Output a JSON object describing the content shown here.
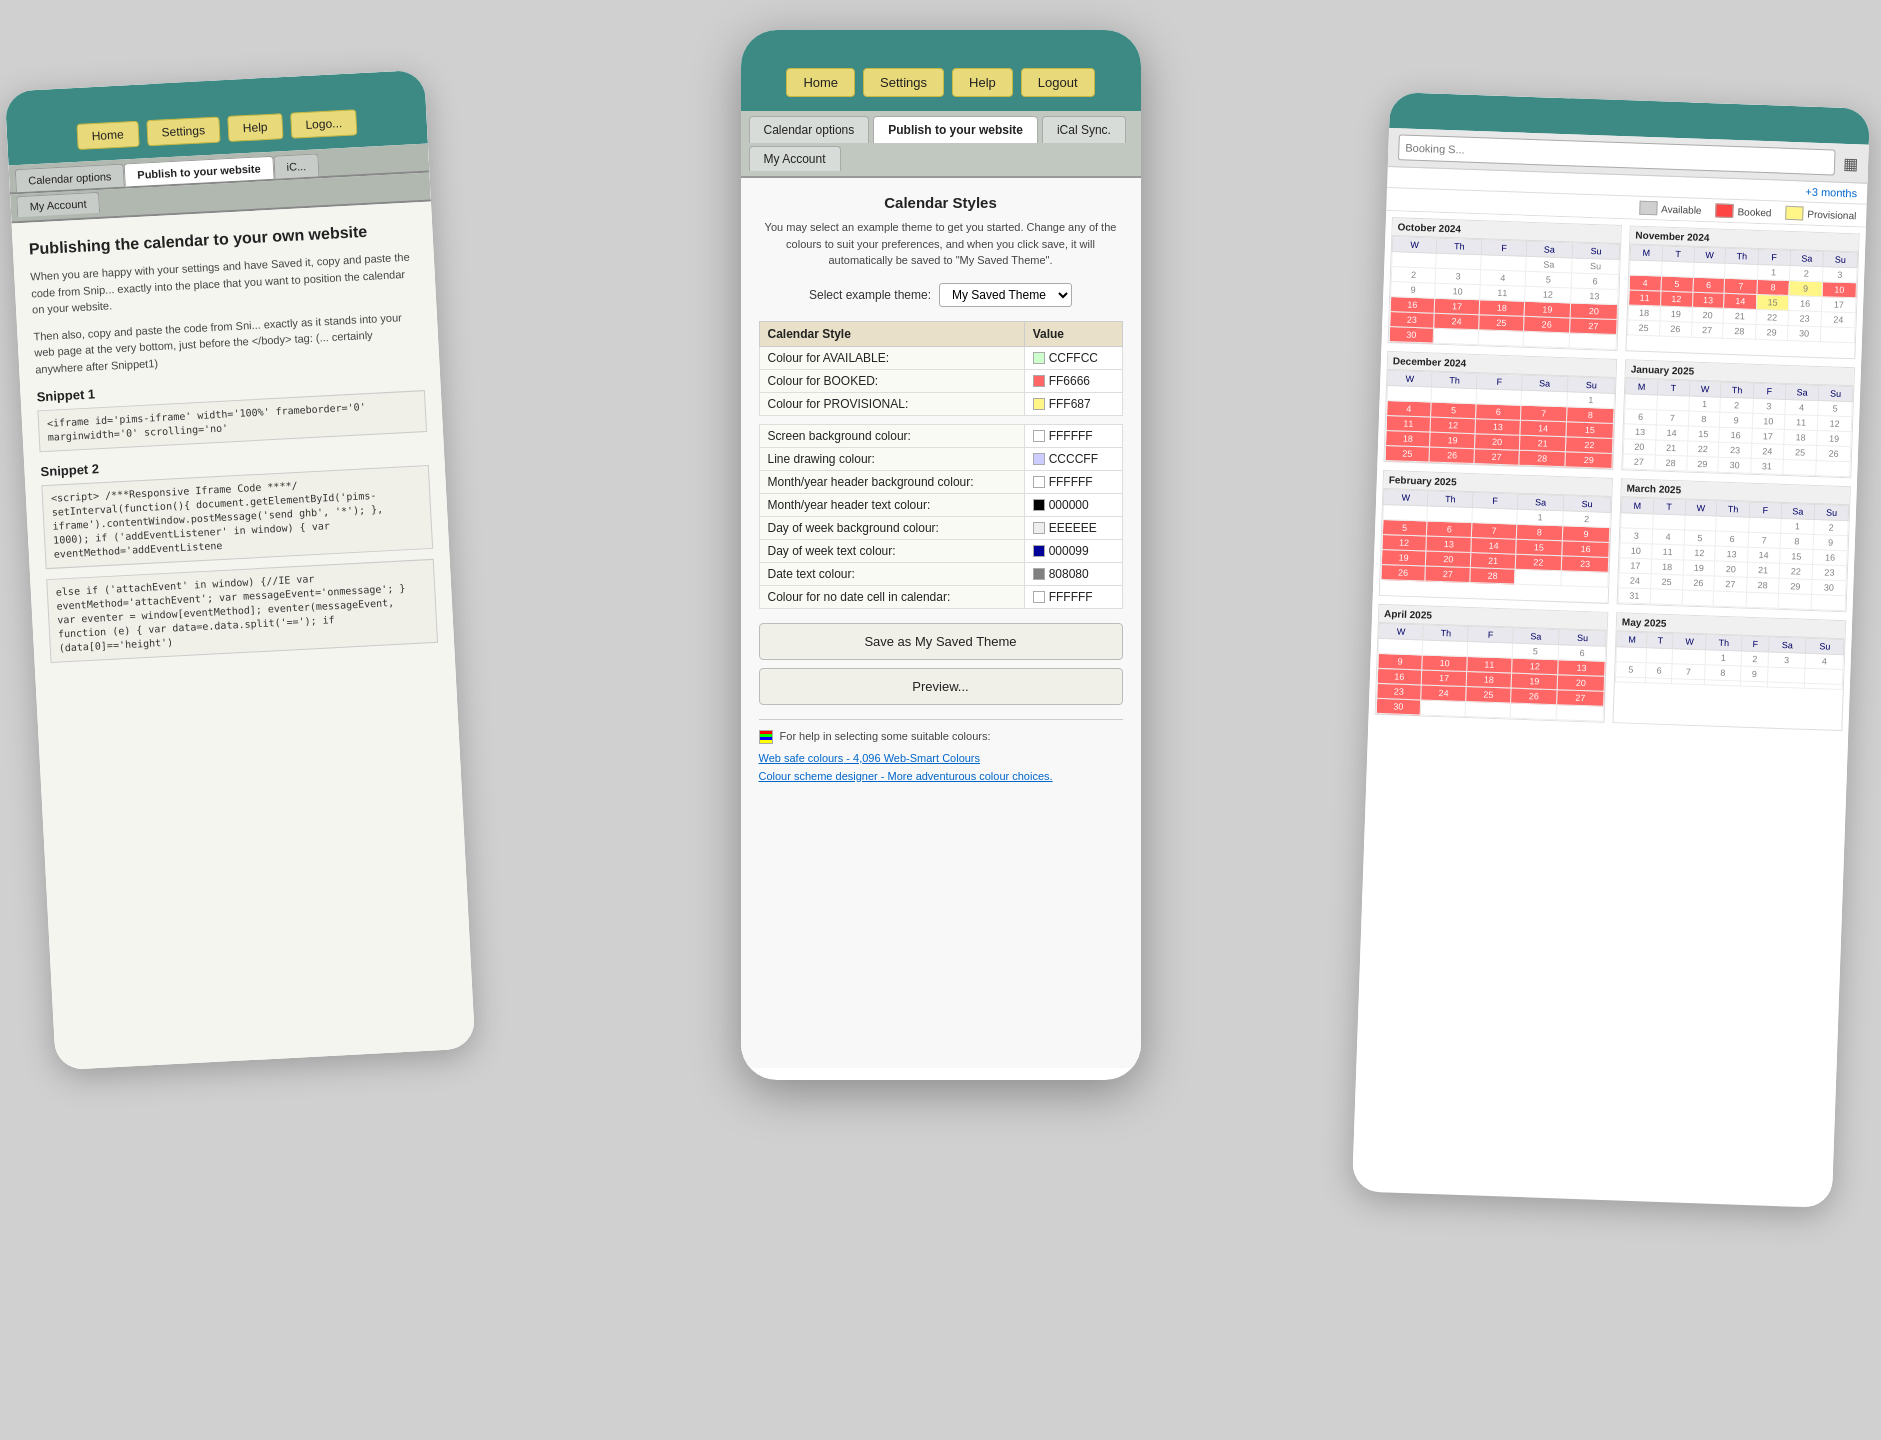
{
  "scene": {
    "bg_color": "#d0d0d0"
  },
  "left_panel": {
    "nav": {
      "buttons": [
        "Home",
        "Settings",
        "Help",
        "Logo..."
      ]
    },
    "tabs_row1": [
      "Calendar options",
      "Publish to your website",
      "iC..."
    ],
    "tabs_row2": [
      "My Account"
    ],
    "active_tab": "Publish to your website",
    "title": "Publishing the calendar to your own website",
    "body": "When you are happy with your settings and have Saved it, copy and paste the code from Snip... exactly into the place that you want to position the calendar on your website.",
    "body2": "Then also, copy and paste the code from Sni... exactly as it stands into your web page at the very bottom, just before the </body> tag: (... certainly anywhere after Snippet1)",
    "snippet1_label": "Snippet 1",
    "snippet1_code": "<iframe id='pims-iframe' width='100%'\nframeborder='0' marginwidth='0'\nscrolling='no'",
    "snippet2_label": "Snippet 2",
    "snippet2_code": "<script>\n/***Responsive Iframe Code ****/\n\nsetInterval(function(){\ndocument.getElementById('pims-\niframe').contentWindow.postMessage('send\nghb', '*'); }, 1000);\nif ('addEventListener' in window)\n{\n\n    var eventMethod='addEventListene\n",
    "snippet2_code2": "else if ('attachEvent' in window)\n{//IE\n    var eventMethod='attachEvent';\n    var messageEvent='onmessage';\n\n}\nvar eventer = window[eventMethod];\neventer(messageEvent, function (e)\n{\n    var data=e.data.split('==');\n    if (data[0]=='height')"
  },
  "center_panel": {
    "nav": {
      "buttons": [
        "Home",
        "Settings",
        "Help",
        "Logout"
      ]
    },
    "tabs_row1": [
      "Calendar options",
      "Publish to your website",
      "iCal Sync."
    ],
    "tabs_row2": [
      "My Account"
    ],
    "active_tab1": "Calendar options",
    "active_tab2": "Publish to your website",
    "calendar_styles": {
      "title": "Calendar Styles",
      "description": "You may select an example theme to get you started. Change any of the colours to suit your preferences, and when you click save, it will automatically be saved to \"My Saved Theme\".",
      "theme_label": "Select example theme:",
      "theme_value": "My Saved Theme",
      "theme_dropdown_arrow": "▼",
      "table_headers": [
        "Calendar Style",
        "Value"
      ],
      "rows": [
        {
          "label": "Colour for AVAILABLE:",
          "value": "CCFFCC"
        },
        {
          "label": "Colour for BOOKED:",
          "value": "FF6666"
        },
        {
          "label": "Colour for PROVISIONAL:",
          "value": "FFF687"
        },
        {
          "label": "",
          "value": ""
        },
        {
          "label": "Screen background colour:",
          "value": "FFFFFF"
        },
        {
          "label": "Line drawing colour:",
          "value": "CCCCFF"
        },
        {
          "label": "Month/year header background colour:",
          "value": "FFFFFF"
        },
        {
          "label": "Month/year header text colour:",
          "value": "000000"
        },
        {
          "label": "Day of week background colour:",
          "value": "EEEEEE"
        },
        {
          "label": "Day of week text colour:",
          "value": "000099"
        },
        {
          "label": "Date text colour:",
          "value": "808080"
        },
        {
          "label": "Colour for no date cell in calendar:",
          "value": "FFFFFF"
        }
      ],
      "save_btn": "Save as My Saved Theme",
      "preview_btn": "Preview...",
      "help_text": "For help in selecting some suitable colours:",
      "link1_label": "Web safe colours",
      "link1_suffix": " - 4,096 Web-Smart Colours",
      "link2_label": "Colour scheme designer",
      "link2_suffix": " - More adventurous colour choices."
    }
  },
  "right_panel": {
    "search_placeholder": "Booking S...",
    "months_link": "+3 months",
    "legend": [
      {
        "label": "Available",
        "color": "#e0e0e0"
      },
      {
        "label": "Booked",
        "color": "#ff4444"
      },
      {
        "label": "Provisional",
        "color": "#fff687"
      }
    ],
    "calendars": [
      {
        "title": "October 2024",
        "headers": [
          "W",
          "Th",
          "F",
          "Sa",
          "Su"
        ],
        "weeks": [
          [
            null,
            null,
            null,
            "Sa",
            "Su"
          ],
          [
            "2",
            "3",
            "4",
            "5",
            "6"
          ],
          [
            "9",
            "10",
            "11",
            "12",
            "13"
          ],
          [
            "16b",
            "17b",
            "18b",
            "19b",
            "20b"
          ],
          [
            "23b",
            "24b",
            "25b",
            "26b",
            "27b"
          ],
          [
            "30b",
            null,
            null,
            null,
            null
          ]
        ]
      },
      {
        "title": "November 2024",
        "headers": [
          "M",
          "T",
          "W",
          "Th",
          "F",
          "Sa",
          "Su"
        ],
        "weeks": [
          [
            null,
            null,
            null,
            null,
            "1",
            "2",
            "3"
          ],
          [
            "4b",
            "5b",
            "6b",
            "7b",
            "8b",
            "9p",
            "10b"
          ],
          [
            "11b",
            "12b",
            "13b",
            "14b",
            "15p",
            "16",
            "17"
          ],
          [
            "18",
            "19",
            "20",
            "21",
            "22",
            "23",
            "24"
          ],
          [
            "25",
            "26",
            "27",
            "28",
            "29",
            "30",
            null
          ]
        ]
      },
      {
        "title": "December 2024",
        "headers": [
          "W",
          "Th",
          "F",
          "Sa",
          "Su"
        ],
        "weeks": [
          [
            null,
            null,
            null,
            null,
            "1"
          ],
          [
            "4b",
            "5b",
            "6b",
            "7b",
            "8b"
          ],
          [
            "11b",
            "12b",
            "13b",
            "14b",
            "15b"
          ],
          [
            "18b",
            "19b",
            "20b",
            "21b",
            "22b"
          ],
          [
            "25b",
            "26b",
            "27b",
            "28b",
            "29b"
          ]
        ]
      },
      {
        "title": "January 2025",
        "headers": [
          "M",
          "T",
          "W",
          "Th",
          "F",
          "Sa",
          "Su"
        ],
        "weeks": [
          [
            null,
            null,
            "1",
            "2",
            "3",
            "4",
            "5"
          ],
          [
            "6",
            "7",
            "8",
            "9",
            "10",
            "11",
            "12"
          ],
          [
            "13",
            "14",
            "15",
            "16",
            "17",
            "18",
            "19"
          ],
          [
            "20",
            "21",
            "22",
            "23",
            "24",
            "25",
            "26"
          ],
          [
            "27",
            "28",
            "29",
            "30",
            "31",
            null,
            null
          ]
        ]
      },
      {
        "title": "February 2025",
        "headers": [
          "W",
          "Th",
          "F",
          "Sa",
          "Su"
        ],
        "weeks": [
          [
            null,
            null,
            null,
            "1",
            "2"
          ],
          [
            "5b",
            "6b",
            "7b",
            "8b",
            "9b"
          ],
          [
            "12b",
            "13b",
            "14b",
            "15b",
            "16b"
          ],
          [
            "19b",
            "20b",
            "21b",
            "22b",
            "23b"
          ],
          [
            "26b",
            "27b",
            "28b",
            null,
            null
          ]
        ]
      },
      {
        "title": "March 2025",
        "headers": [
          "M",
          "T",
          "W",
          "Th",
          "F",
          "Sa",
          "Su"
        ],
        "weeks": [
          [
            null,
            null,
            null,
            null,
            null,
            "1",
            "2"
          ],
          [
            "3",
            "4",
            "5",
            "6",
            "7",
            "8",
            "9"
          ],
          [
            "10",
            "11",
            "12",
            "13",
            "14",
            "15",
            "16"
          ],
          [
            "17",
            "18",
            "19",
            "20",
            "21",
            "22",
            "23"
          ],
          [
            "24",
            "25",
            "26",
            "27",
            "28",
            "29",
            "30"
          ],
          [
            "31",
            null,
            null,
            null,
            null,
            null,
            null
          ]
        ]
      },
      {
        "title": "April 2025",
        "headers": [
          "W",
          "Th",
          "F",
          "Sa",
          "Su"
        ],
        "weeks": [
          [
            null,
            null,
            null,
            "5",
            "6"
          ],
          [
            "9b",
            "10b",
            "11b",
            "12b",
            "13b"
          ],
          [
            "16b",
            "17b",
            "18b",
            "19b",
            "20b"
          ],
          [
            "23b",
            "24b",
            "25b",
            "26b",
            "27b"
          ],
          [
            "30b",
            null,
            null,
            null,
            null
          ]
        ]
      },
      {
        "title": "May 2025",
        "headers": [
          "M",
          "T",
          "W",
          "Th",
          "F",
          "Sa",
          "Su"
        ],
        "weeks": [
          [
            null,
            null,
            null,
            "1",
            "2",
            "3",
            "4"
          ],
          [
            "5",
            "6",
            "7",
            "8",
            "9",
            null,
            null
          ],
          [
            null,
            null,
            null,
            null,
            null,
            null,
            null
          ]
        ]
      }
    ]
  }
}
